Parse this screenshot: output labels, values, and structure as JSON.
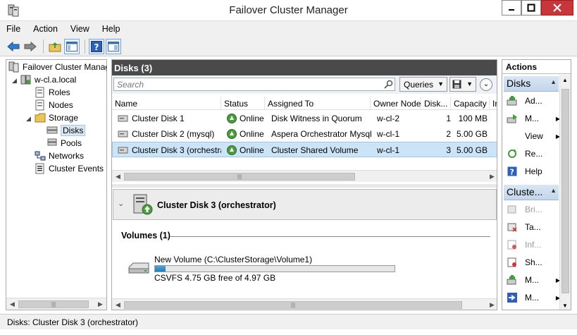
{
  "window": {
    "title": "Failover Cluster Manager"
  },
  "menu": [
    "File",
    "Action",
    "View",
    "Help"
  ],
  "tree": {
    "root": "Failover Cluster Manag",
    "cluster": "w-cl.a.local",
    "roles": "Roles",
    "nodes": "Nodes",
    "storage": "Storage",
    "disks": "Disks",
    "pools": "Pools",
    "networks": "Networks",
    "events": "Cluster Events"
  },
  "center": {
    "header": "Disks (3)",
    "search_placeholder": "Search",
    "queries_label": "Queries",
    "columns": [
      "Name",
      "Status",
      "Assigned To",
      "Owner Node",
      "Disk...",
      "Capacity",
      "Ir"
    ],
    "rows": [
      {
        "name": "Cluster Disk 1",
        "status": "Online",
        "assigned": "Disk Witness in Quorum",
        "owner": "w-cl-2",
        "disk": "1",
        "capacity": "100 MB"
      },
      {
        "name": "Cluster Disk 2 (mysql)",
        "status": "Online",
        "assigned": "Aspera Orchestrator Mysql",
        "owner": "w-cl-1",
        "disk": "2",
        "capacity": "5.00 GB"
      },
      {
        "name": "Cluster Disk 3 (orchestra...",
        "status": "Online",
        "assigned": "Cluster Shared Volume",
        "owner": "w-cl-1",
        "disk": "3",
        "capacity": "5.00 GB"
      }
    ]
  },
  "detail": {
    "title": "Cluster Disk 3 (orchestrator)",
    "volumes_label": "Volumes (1)",
    "volume_name": "New Volume (C:\\ClusterStorage\\Volume1)",
    "volume_used_fraction": 0.044,
    "volume_free": "CSVFS 4.75 GB free of 4.97 GB"
  },
  "actions": {
    "title": "Actions",
    "group1": "Disks",
    "items1": [
      "Ad...",
      "M...",
      "View",
      "Re...",
      "Help"
    ],
    "group2": "Cluste...",
    "items2": [
      "Bri...",
      "Ta...",
      "Inf...",
      "Sh...",
      "M...",
      "M..."
    ]
  },
  "status": {
    "text": "Disks:  Cluster Disk 3 (orchestrator)"
  },
  "colors": {
    "header_bg": "#4a4a4a",
    "selection": "#cce4f7",
    "online": "#4c9b3d",
    "close": "#c7363a"
  }
}
